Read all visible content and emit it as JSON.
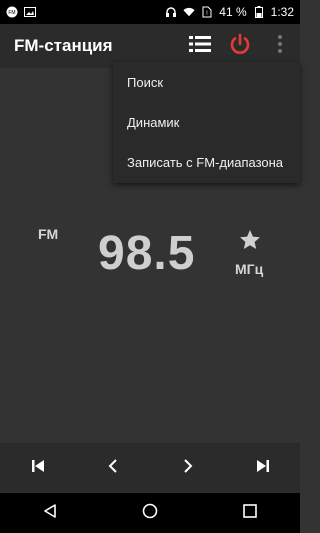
{
  "status_bar": {
    "battery_percent": "41 %",
    "time": "1:32",
    "icons": [
      "notification-fm-icon",
      "image-icon",
      "headphones-icon",
      "wifi-icon",
      "no-sim-icon",
      "battery-icon"
    ]
  },
  "app_bar": {
    "title": "FM-станция",
    "icons": [
      "list-icon",
      "power-icon",
      "overflow-menu-icon"
    ],
    "power_color": "#e53935"
  },
  "menu": {
    "items": [
      "Поиск",
      "Динамик",
      "Записать с FM-диапазона"
    ]
  },
  "radio": {
    "band": "FM",
    "frequency": "98.5",
    "unit": "МГц"
  },
  "controls": {
    "icons": [
      "skip-previous-icon",
      "step-back-icon",
      "step-forward-icon",
      "skip-next-icon"
    ]
  },
  "nav_bar": {
    "icons": [
      "back-icon",
      "home-icon",
      "recents-icon"
    ]
  }
}
